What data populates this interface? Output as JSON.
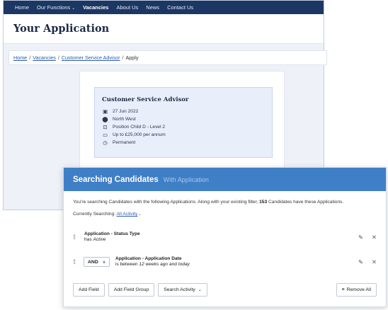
{
  "nav": {
    "items": [
      {
        "label": "Home"
      },
      {
        "label": "Our Functions",
        "has_dropdown": true
      },
      {
        "label": "Vacancies",
        "active": true
      },
      {
        "label": "About Us"
      },
      {
        "label": "News"
      },
      {
        "label": "Contact Us"
      }
    ],
    "bg_color": "#1c3764"
  },
  "page": {
    "title": "Your Application"
  },
  "breadcrumb": {
    "items": [
      "Home",
      "Vacancies",
      "Customer Service Advisor"
    ],
    "current": "Apply",
    "separator": "/"
  },
  "job": {
    "title": "Customer Service Advisor",
    "details": [
      {
        "icon": "calendar-icon",
        "text": "27 Jun 2022"
      },
      {
        "icon": "location-pin-icon",
        "text": "North West"
      },
      {
        "icon": "id-badge-icon",
        "text": "Position Child D - Level 2"
      },
      {
        "icon": "money-icon",
        "text": "Up to £25,000 per annum"
      },
      {
        "icon": "clock-icon",
        "text": "Permanent"
      }
    ]
  },
  "modal": {
    "title": "Searching Candidates",
    "subtitle": "With Application",
    "header_color": "#3f7fc6",
    "info_before": "You're searching Candidates with the following Applications. Along with your existing filter,",
    "info_count": "153",
    "info_after": "Candidates have these Applications.",
    "currently_label": "Currently Searching:",
    "currently_value": "All Activity",
    "filters": [
      {
        "field": "Application - Status Type",
        "prefix": "has",
        "value": "Active"
      },
      {
        "operator": "AND",
        "field": "Application - Application Date",
        "prefix": "is between",
        "value_from": "12 weeks ago",
        "joiner": "and",
        "value_to": "today"
      }
    ],
    "buttons": {
      "add_field": "Add Field",
      "add_field_group": "Add Field Group",
      "search_activity": "Search Activity",
      "remove_all": "Remove All"
    }
  }
}
